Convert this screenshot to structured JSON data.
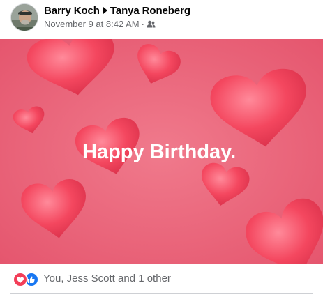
{
  "post": {
    "author": "Barry Koch",
    "recipient": "Tanya Roneberg",
    "timestamp": "November 9 at 8:42 AM",
    "separator": "·",
    "audience_icon": "friends-icon",
    "media": {
      "greeting": "Happy Birthday.",
      "background_color": "#e8566f",
      "heart_color": "#f24a62"
    },
    "reactions": {
      "icons": [
        "love-icon",
        "like-icon"
      ],
      "summary": "You, Jess Scott and 1 other"
    }
  }
}
